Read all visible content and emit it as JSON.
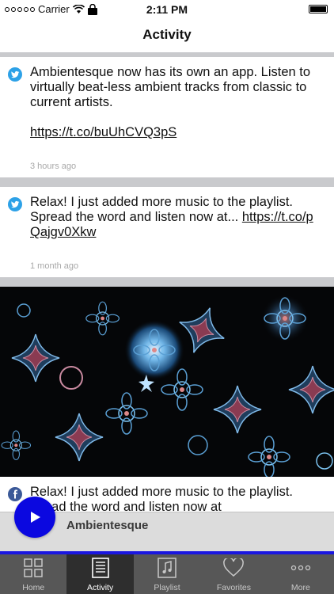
{
  "status_bar": {
    "carrier": "Carrier",
    "time": "2:11 PM"
  },
  "nav": {
    "title": "Activity"
  },
  "posts": [
    {
      "source": "twitter-icon",
      "text": "Ambientesque now has its own an app. Listen to virtually beat-less ambient tracks from classic to current artists.",
      "link": "https://t.co/buUhCVQ3pS",
      "time": "3 hours ago"
    },
    {
      "source": "twitter-icon",
      "text": "Relax! I just added more music to the playlist. Spread the word and listen now at...",
      "link": "https://t.co/pQajgv0Xkw",
      "time": "1 month ago"
    },
    {
      "source": "facebook-icon",
      "text_line1": "Relax! I just added more music to the playlist.",
      "text_line2": "ead the word and listen now at"
    }
  ],
  "player": {
    "title": "Ambientesque"
  },
  "tabs": [
    {
      "label": "Home",
      "icon": "grid-icon"
    },
    {
      "label": "Activity",
      "icon": "news-icon",
      "active": true
    },
    {
      "label": "Playlist",
      "icon": "music-note-icon"
    },
    {
      "label": "Favorites",
      "icon": "heart-icon"
    },
    {
      "label": "More",
      "icon": "more-icon"
    }
  ],
  "colors": {
    "twitter": "#2da1e7",
    "facebook": "#3b5998",
    "play_button": "#0b08e0",
    "tab_bar": "#575757",
    "tab_active": "#2e2e2e"
  }
}
